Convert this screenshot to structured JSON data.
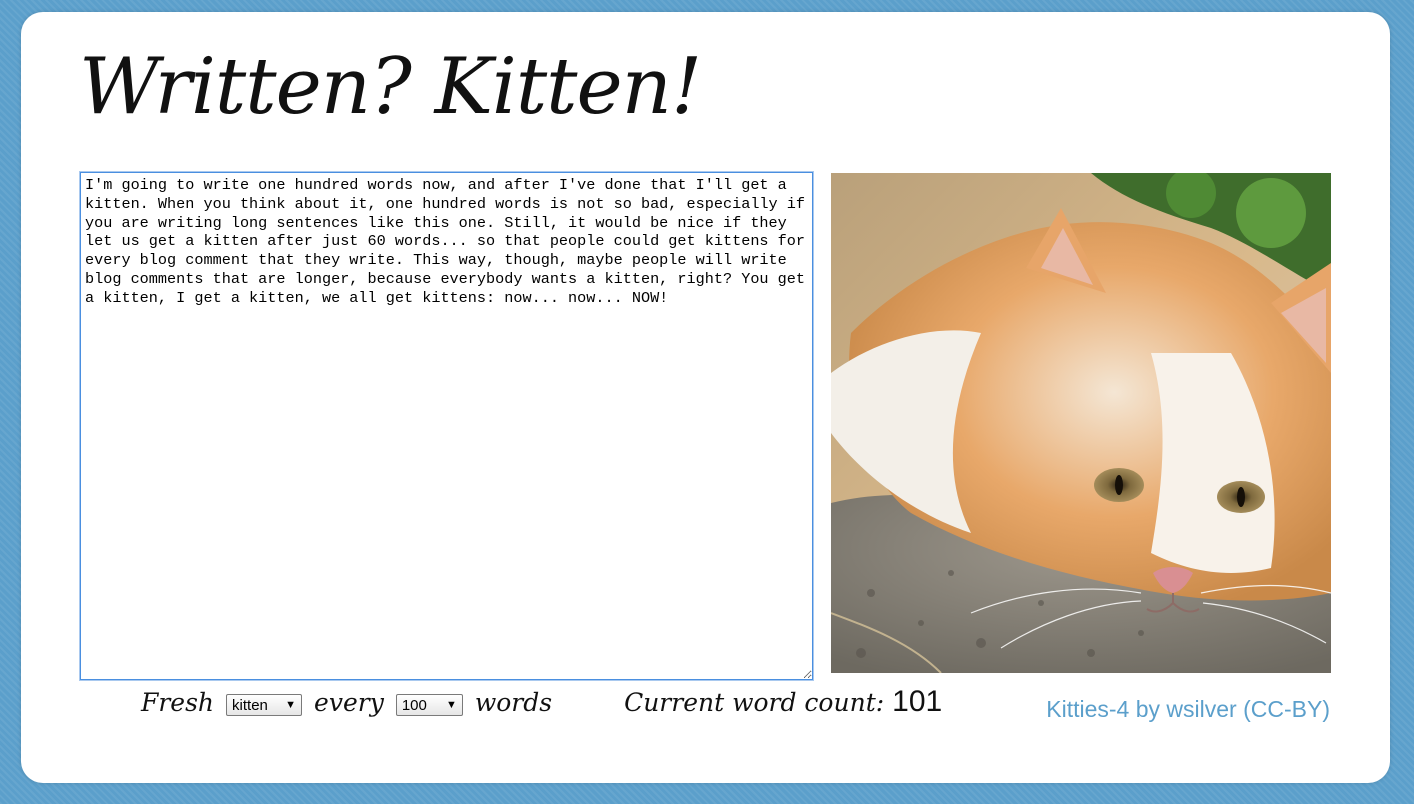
{
  "app": {
    "title": "Written? Kitten!"
  },
  "editor": {
    "text": "I'm going to write one hundred words now, and after I've done that I'll get a kitten. When you think about it, one hundred words is not so bad, especially if you are writing long sentences like this one. Still, it would be nice if they let us get a kitten after just 60 words... so that people could get kittens for every blog comment that they write. This way, though, maybe people will write blog comments that are longer, because everybody wants a kitten, right? You get a kitten, I get a kitten, we all get kittens: now... now... NOW!"
  },
  "controls": {
    "fresh_label": "Fresh",
    "animal_select": {
      "value": "kitten"
    },
    "every_label": "every",
    "words_select": {
      "value": "100"
    },
    "words_label": "words",
    "count_label": "Current word count:",
    "count_value": "101"
  },
  "credit": {
    "image_title": "Kitties-4",
    "by": "by",
    "author": "wsilver",
    "license": "CC-BY"
  },
  "colors": {
    "background": "#5b9fcb",
    "card": "#ffffff",
    "link": "#5b9fcb",
    "editor_focus_border": "#4a8fe0"
  },
  "icons": {
    "select_arrow": "dropdown-arrow-icon"
  }
}
